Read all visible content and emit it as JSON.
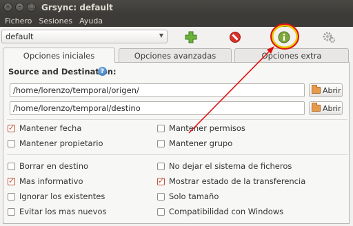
{
  "window": {
    "title": "Grsync: default"
  },
  "menu": [
    "Fichero",
    "Sesiones",
    "Ayuda"
  ],
  "session": {
    "value": "default"
  },
  "toolbar": {
    "add_icon": "plus-green-icon",
    "delete_icon": "no-entry-red-icon",
    "info_icon": "info-green-icon",
    "execute_icon": "gears-icon"
  },
  "tabs": [
    "Opciones iniciales",
    "Opciones avanzadas",
    "Opciones extra"
  ],
  "section": {
    "label": "Source and Destination:"
  },
  "source": {
    "path": "/home/lorenzo/temporal/origen/",
    "button": "Abrir"
  },
  "destination": {
    "path": "/home/lorenzo/temporal/destino",
    "button": "Abrir"
  },
  "options": {
    "left": [
      {
        "label": "Mantener fecha",
        "checked": true
      },
      {
        "label": "Mantener propietario",
        "checked": false
      },
      {
        "label": "Borrar en destino",
        "checked": false
      },
      {
        "label": "Mas informativo",
        "checked": true
      },
      {
        "label": "Ignorar los existentes",
        "checked": false
      },
      {
        "label": "Evitar los mas nuevos",
        "checked": false
      }
    ],
    "right": [
      {
        "label": "Mantener permisos",
        "checked": false
      },
      {
        "label": "Mantener grupo",
        "checked": false
      },
      {
        "label": "No dejar el sistema de ficheros",
        "checked": false
      },
      {
        "label": "Mostrar estado de la transferencia",
        "checked": true
      },
      {
        "label": "Solo tamaño",
        "checked": false
      },
      {
        "label": "Compatibilidad con Windows",
        "checked": false
      }
    ]
  },
  "colors": {
    "annotation": "#e01010",
    "highlight_ring": "#e5c800"
  }
}
